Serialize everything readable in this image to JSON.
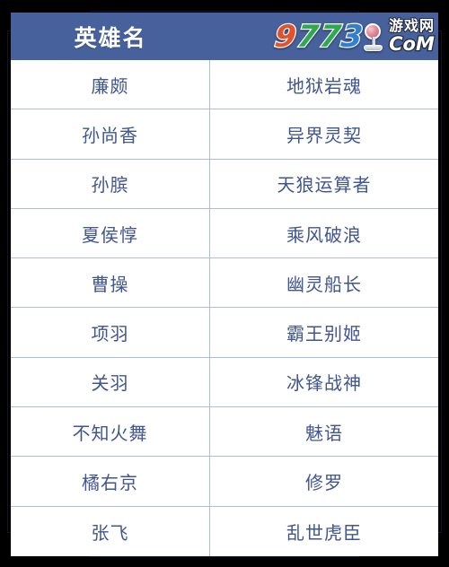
{
  "colors": {
    "page_background": "#000000",
    "header_blue": "#46619c",
    "grid_line": "#aebbd9",
    "cell_text": "#41568f",
    "frame_line": "#0e1430",
    "card_background": "#ffffff"
  },
  "frame": {
    "name": "decorative-bracket-frame"
  },
  "table": {
    "header": {
      "title": "英雄名",
      "second_column_title": ""
    },
    "columns": [
      "英雄名",
      ""
    ],
    "rows": [
      {
        "hero": "廉颇",
        "skin": "地狱岩魂"
      },
      {
        "hero": "孙尚香",
        "skin": "异界灵契"
      },
      {
        "hero": "孙膑",
        "skin": "天狼运算者"
      },
      {
        "hero": "夏侯惇",
        "skin": "乘风破浪"
      },
      {
        "hero": "曹操",
        "skin": "幽灵船长"
      },
      {
        "hero": "项羽",
        "skin": "霸王别姬"
      },
      {
        "hero": "关羽",
        "skin": "冰锋战神"
      },
      {
        "hero": "不知火舞",
        "skin": "魅语"
      },
      {
        "hero": "橘右京",
        "skin": "修罗"
      },
      {
        "hero": "张飞",
        "skin": "乱世虎臣"
      }
    ]
  },
  "watermark": {
    "name": "9773-game-site-logo",
    "digits": [
      "9",
      "7",
      "7",
      "3"
    ],
    "joystick_icon": "joystick-icon",
    "chinese_text": "游戏网",
    "domain_text": "CoM"
  }
}
